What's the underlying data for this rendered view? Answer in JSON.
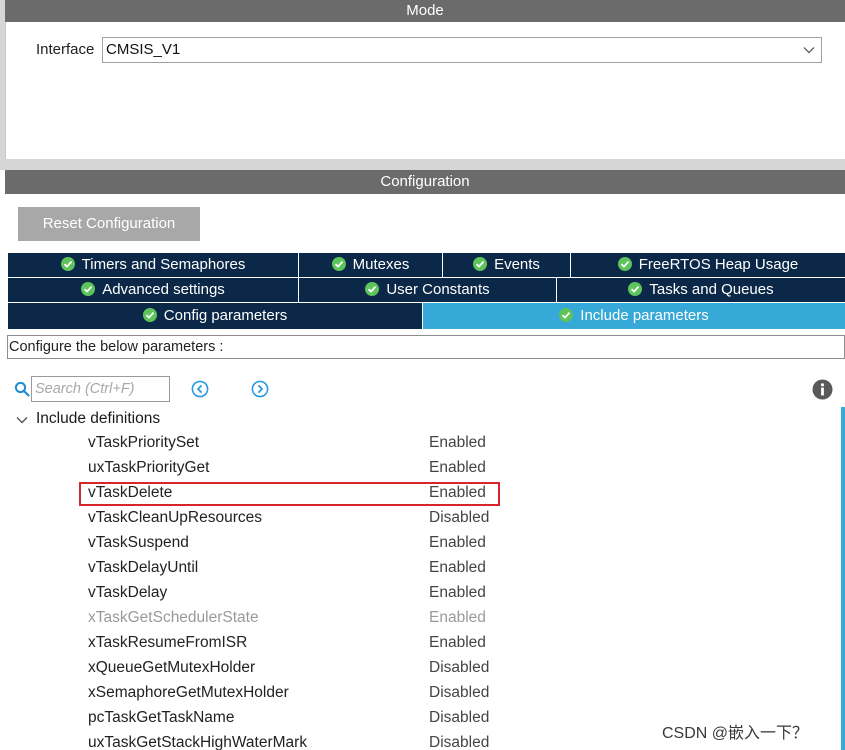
{
  "mode": {
    "header": "Mode",
    "interface_label": "Interface",
    "interface_value": "CMSIS_V1"
  },
  "configuration": {
    "header": "Configuration",
    "reset_label": "Reset Configuration",
    "tabs_row1": [
      "Timers and Semaphores",
      "Mutexes",
      "Events",
      "FreeRTOS Heap Usage"
    ],
    "tabs_row2": [
      "Advanced settings",
      "User Constants",
      "Tasks and Queues"
    ],
    "tabs_row3": [
      "Config parameters",
      "Include parameters"
    ],
    "active_tab": "Include parameters",
    "hint": "Configure the below parameters :",
    "search_placeholder": "Search (Ctrl+F)",
    "tree_title": "Include definitions",
    "rows": [
      {
        "name": "vTaskPrioritySet",
        "value": "Enabled",
        "disabled": false
      },
      {
        "name": "uxTaskPriorityGet",
        "value": "Enabled",
        "disabled": false
      },
      {
        "name": "vTaskDelete",
        "value": "Enabled",
        "disabled": false,
        "highlighted": true
      },
      {
        "name": "vTaskCleanUpResources",
        "value": "Disabled",
        "disabled": false
      },
      {
        "name": "vTaskSuspend",
        "value": "Enabled",
        "disabled": false
      },
      {
        "name": "vTaskDelayUntil",
        "value": "Enabled",
        "disabled": false
      },
      {
        "name": "vTaskDelay",
        "value": "Enabled",
        "disabled": false
      },
      {
        "name": "xTaskGetSchedulerState",
        "value": "Enabled",
        "disabled": true
      },
      {
        "name": "xTaskResumeFromISR",
        "value": "Enabled",
        "disabled": false
      },
      {
        "name": "xQueueGetMutexHolder",
        "value": "Disabled",
        "disabled": false
      },
      {
        "name": "xSemaphoreGetMutexHolder",
        "value": "Disabled",
        "disabled": false
      },
      {
        "name": "pcTaskGetTaskName",
        "value": "Disabled",
        "disabled": false
      },
      {
        "name": "uxTaskGetStackHighWaterMark",
        "value": "Disabled",
        "disabled": false
      }
    ]
  },
  "watermark": "CSDN @嵌入一下？",
  "colors": {
    "header_bg": "#6b6b6b",
    "tab_bg": "#0b2848",
    "tab_active_bg": "#36a9d8",
    "highlight_border": "#d7262b",
    "check_icon_fill": "#5cc45a"
  },
  "icons": [
    "chevron-down-icon",
    "check-circle-icon",
    "search-icon",
    "arrow-left-circle-icon",
    "arrow-right-circle-icon",
    "info-icon",
    "tree-expand-icon"
  ]
}
